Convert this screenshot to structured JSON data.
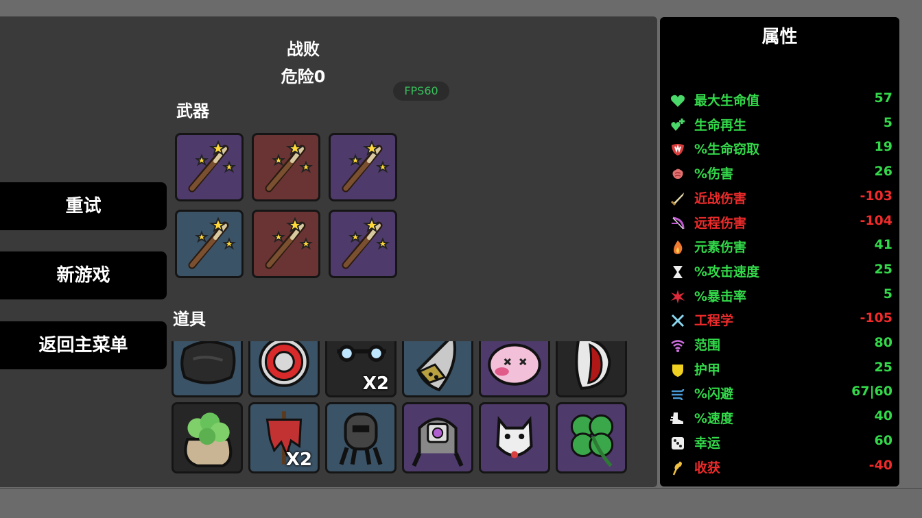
{
  "header": {
    "title": "战败",
    "danger": "危险0",
    "fps": "FPS60"
  },
  "menu": {
    "retry": "重试",
    "new_game": "新游戏",
    "main_menu": "返回主菜单"
  },
  "weapons_label": "武器",
  "items_label": "道具",
  "weapons": [
    {
      "tier": "purple",
      "icon": "magic-wand"
    },
    {
      "tier": "red",
      "icon": "magic-wand"
    },
    {
      "tier": "purple",
      "icon": "magic-wand"
    },
    {
      "tier": "blue",
      "icon": "magic-wand"
    },
    {
      "tier": "red",
      "icon": "magic-wand"
    },
    {
      "tier": "purple",
      "icon": "magic-wand"
    }
  ],
  "items": [
    {
      "tier": "blue",
      "icon": "black-pillow",
      "count": ""
    },
    {
      "tier": "blue",
      "icon": "red-ring",
      "count": ""
    },
    {
      "tier": "gray",
      "icon": "glasses",
      "count": "X2"
    },
    {
      "tier": "blue",
      "icon": "metal-claw",
      "count": ""
    },
    {
      "tier": "purple",
      "icon": "pink-blob",
      "count": ""
    },
    {
      "tier": "gray",
      "icon": "fanged-mouth",
      "count": ""
    },
    {
      "tier": "gray",
      "icon": "seed-bag",
      "count": ""
    },
    {
      "tier": "blue",
      "icon": "red-scarecrow",
      "count": "X2"
    },
    {
      "tier": "blue",
      "icon": "turret",
      "count": ""
    },
    {
      "tier": "purple",
      "icon": "robot-drone",
      "count": ""
    },
    {
      "tier": "purple",
      "icon": "lucky-cat",
      "count": ""
    },
    {
      "tier": "purple",
      "icon": "four-leaf-clover",
      "count": ""
    }
  ],
  "stats": {
    "title": "属性",
    "rows": [
      {
        "name": "最大生命值",
        "value": "57",
        "positive": true,
        "icon": "heart-icon"
      },
      {
        "name": "生命再生",
        "value": "5",
        "positive": true,
        "icon": "regen-heart-icon"
      },
      {
        "name": "%生命窃取",
        "value": "19",
        "positive": true,
        "icon": "fang-mouth-icon"
      },
      {
        "name": "%伤害",
        "value": "26",
        "positive": true,
        "icon": "brain-icon"
      },
      {
        "name": "近战伤害",
        "value": "-103",
        "positive": false,
        "icon": "sword-icon"
      },
      {
        "name": "远程伤害",
        "value": "-104",
        "positive": false,
        "icon": "bow-icon"
      },
      {
        "name": "元素伤害",
        "value": "41",
        "positive": true,
        "icon": "flame-icon"
      },
      {
        "name": "%攻击速度",
        "value": "25",
        "positive": true,
        "icon": "hourglass-icon"
      },
      {
        "name": "%暴击率",
        "value": "5",
        "positive": true,
        "icon": "crit-burst-icon"
      },
      {
        "name": "工程学",
        "value": "-105",
        "positive": false,
        "icon": "wrench-cross-icon"
      },
      {
        "name": "范围",
        "value": "80",
        "positive": true,
        "icon": "range-wave-icon"
      },
      {
        "name": "护甲",
        "value": "25",
        "positive": true,
        "icon": "shield-icon"
      },
      {
        "name": "%闪避",
        "value": "67|60",
        "positive": true,
        "icon": "dodge-wind-icon"
      },
      {
        "name": "%速度",
        "value": "40",
        "positive": true,
        "icon": "boot-icon"
      },
      {
        "name": "幸运",
        "value": "60",
        "positive": true,
        "icon": "dice-icon"
      },
      {
        "name": "收获",
        "value": "-40",
        "positive": false,
        "icon": "harvest-wheat-icon"
      }
    ]
  },
  "colors": {
    "positive": "#33d94a",
    "negative": "#ef2b2b",
    "tier_gray": "#262626",
    "tier_blue": "#3b5366",
    "tier_purple": "#4e3a6b",
    "tier_red": "#6b3434"
  }
}
